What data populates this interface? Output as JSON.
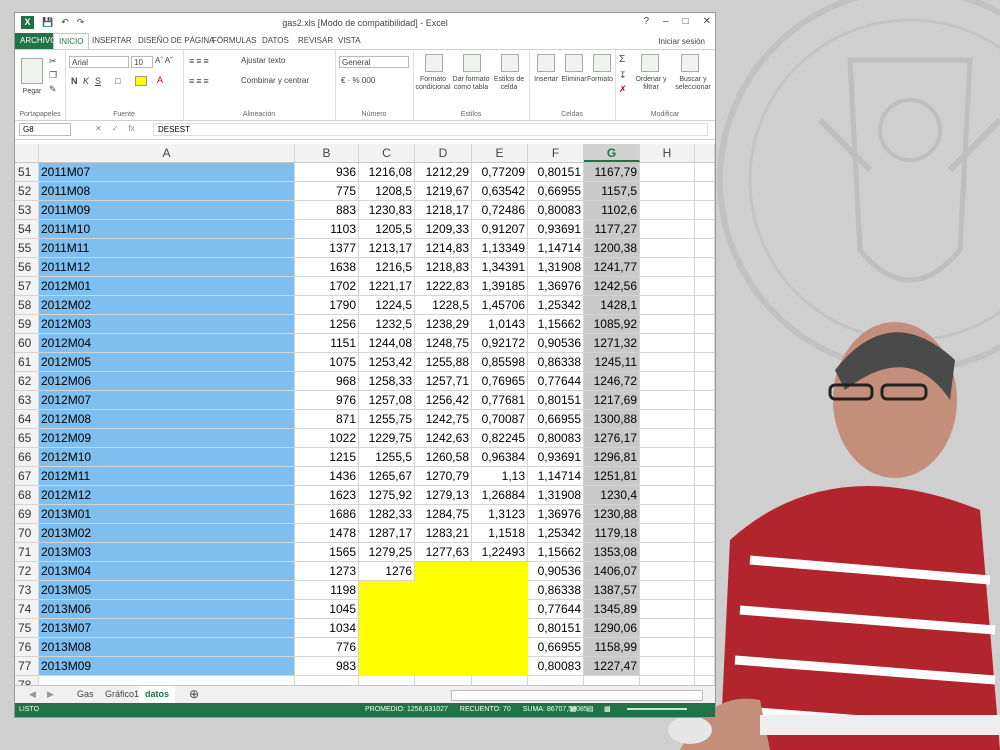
{
  "window": {
    "title": "gas2.xls  [Modo de compatibilidad] - Excel",
    "controls": [
      "?",
      "–",
      "□",
      "✕"
    ]
  },
  "ribbon": {
    "tabs": [
      "ARCHIVO",
      "INICIO",
      "INSERTAR",
      "DISEÑO DE PÁGINA",
      "FÓRMULAS",
      "DATOS",
      "REVISAR",
      "VISTA"
    ],
    "signin": "Iniciar sesión",
    "paste_label": "Pegar",
    "font_name": "Arial",
    "font_size": "10",
    "wrap_text": "Ajustar texto",
    "merge_center": "Combinar y centrar",
    "number_format": "General",
    "buttons": {
      "conditional": "Formato condicional",
      "as_table": "Dar formato como tabla",
      "cell_styles": "Estilos de celda",
      "insert": "Insertar",
      "delete": "Eliminar",
      "format": "Formato",
      "sort": "Ordenar y filtrar",
      "find": "Buscar y seleccionar"
    },
    "groups": [
      "Portapapeles",
      "Fuente",
      "Alineación",
      "Número",
      "Estilos",
      "Celdas",
      "Modificar"
    ]
  },
  "formula_bar": {
    "name_box": "G8",
    "fx": "fx",
    "formula": "DESEST"
  },
  "columns": [
    "A",
    "B",
    "C",
    "D",
    "E",
    "F",
    "G",
    "H"
  ],
  "rows": [
    {
      "n": "51",
      "a": "2011M07",
      "b": "936",
      "c": "1216,08",
      "d": "1212,29",
      "e": "0,77209",
      "f": "0,80151",
      "g": "1167,79"
    },
    {
      "n": "52",
      "a": "2011M08",
      "b": "775",
      "c": "1208,5",
      "d": "1219,67",
      "e": "0,63542",
      "f": "0,66955",
      "g": "1157,5"
    },
    {
      "n": "53",
      "a": "2011M09",
      "b": "883",
      "c": "1230,83",
      "d": "1218,17",
      "e": "0,72486",
      "f": "0,80083",
      "g": "1102,6"
    },
    {
      "n": "54",
      "a": "2011M10",
      "b": "1103",
      "c": "1205,5",
      "d": "1209,33",
      "e": "0,91207",
      "f": "0,93691",
      "g": "1177,27"
    },
    {
      "n": "55",
      "a": "2011M11",
      "b": "1377",
      "c": "1213,17",
      "d": "1214,83",
      "e": "1,13349",
      "f": "1,14714",
      "g": "1200,38"
    },
    {
      "n": "56",
      "a": "2011M12",
      "b": "1638",
      "c": "1216,5",
      "d": "1218,83",
      "e": "1,34391",
      "f": "1,31908",
      "g": "1241,77"
    },
    {
      "n": "57",
      "a": "2012M01",
      "b": "1702",
      "c": "1221,17",
      "d": "1222,83",
      "e": "1,39185",
      "f": "1,36976",
      "g": "1242,56"
    },
    {
      "n": "58",
      "a": "2012M02",
      "b": "1790",
      "c": "1224,5",
      "d": "1228,5",
      "e": "1,45706",
      "f": "1,25342",
      "g": "1428,1"
    },
    {
      "n": "59",
      "a": "2012M03",
      "b": "1256",
      "c": "1232,5",
      "d": "1238,29",
      "e": "1,0143",
      "f": "1,15662",
      "g": "1085,92"
    },
    {
      "n": "60",
      "a": "2012M04",
      "b": "1151",
      "c": "1244,08",
      "d": "1248,75",
      "e": "0,92172",
      "f": "0,90536",
      "g": "1271,32"
    },
    {
      "n": "61",
      "a": "2012M05",
      "b": "1075",
      "c": "1253,42",
      "d": "1255,88",
      "e": "0,85598",
      "f": "0,86338",
      "g": "1245,11"
    },
    {
      "n": "62",
      "a": "2012M06",
      "b": "968",
      "c": "1258,33",
      "d": "1257,71",
      "e": "0,76965",
      "f": "0,77644",
      "g": "1246,72"
    },
    {
      "n": "63",
      "a": "2012M07",
      "b": "976",
      "c": "1257,08",
      "d": "1256,42",
      "e": "0,77681",
      "f": "0,80151",
      "g": "1217,69"
    },
    {
      "n": "64",
      "a": "2012M08",
      "b": "871",
      "c": "1255,75",
      "d": "1242,75",
      "e": "0,70087",
      "f": "0,66955",
      "g": "1300,88"
    },
    {
      "n": "65",
      "a": "2012M09",
      "b": "1022",
      "c": "1229,75",
      "d": "1242,63",
      "e": "0,82245",
      "f": "0,80083",
      "g": "1276,17"
    },
    {
      "n": "66",
      "a": "2012M10",
      "b": "1215",
      "c": "1255,5",
      "d": "1260,58",
      "e": "0,96384",
      "f": "0,93691",
      "g": "1296,81"
    },
    {
      "n": "67",
      "a": "2012M11",
      "b": "1436",
      "c": "1265,67",
      "d": "1270,79",
      "e": "1,13",
      "f": "1,14714",
      "g": "1251,81"
    },
    {
      "n": "68",
      "a": "2012M12",
      "b": "1623",
      "c": "1275,92",
      "d": "1279,13",
      "e": "1,26884",
      "f": "1,31908",
      "g": "1230,4"
    },
    {
      "n": "69",
      "a": "2013M01",
      "b": "1686",
      "c": "1282,33",
      "d": "1284,75",
      "e": "1,3123",
      "f": "1,36976",
      "g": "1230,88"
    },
    {
      "n": "70",
      "a": "2013M02",
      "b": "1478",
      "c": "1287,17",
      "d": "1283,21",
      "e": "1,1518",
      "f": "1,25342",
      "g": "1179,18"
    },
    {
      "n": "71",
      "a": "2013M03",
      "b": "1565",
      "c": "1279,25",
      "d": "1277,63",
      "e": "1,22493",
      "f": "1,15662",
      "g": "1353,08"
    },
    {
      "n": "72",
      "a": "2013M04",
      "b": "1273",
      "c": "1276",
      "d": "",
      "e": "",
      "f": "0,90536",
      "g": "1406,07"
    },
    {
      "n": "73",
      "a": "2013M05",
      "b": "1198",
      "c": "",
      "d": "",
      "e": "",
      "f": "0,86338",
      "g": "1387,57"
    },
    {
      "n": "74",
      "a": "2013M06",
      "b": "1045",
      "c": "",
      "d": "",
      "e": "",
      "f": "0,77644",
      "g": "1345,89"
    },
    {
      "n": "75",
      "a": "2013M07",
      "b": "1034",
      "c": "",
      "d": "",
      "e": "",
      "f": "0,80151",
      "g": "1290,06"
    },
    {
      "n": "76",
      "a": "2013M08",
      "b": "776",
      "c": "",
      "d": "",
      "e": "",
      "f": "0,66955",
      "g": "1158,99"
    },
    {
      "n": "77",
      "a": "2013M09",
      "b": "983",
      "c": "",
      "d": "",
      "e": "",
      "f": "0,80083",
      "g": "1227,47"
    },
    {
      "n": "78",
      "a": "",
      "b": "",
      "c": "",
      "d": "",
      "e": "",
      "f": "",
      "g": ""
    }
  ],
  "sheet_tabs": [
    "Gas",
    "Gráfico1",
    "datos"
  ],
  "active_sheet": "datos",
  "status": {
    "mode": "LISTO",
    "promedio": "PROMEDIO: 1256,631027",
    "recuento": "RECUENTO: 70",
    "suma": "SUMA: 86707,54085"
  },
  "colors": {
    "excel_green": "#217346",
    "selection_blue": "#7fbff0",
    "highlight_yellow": "#ffff00",
    "selected_column_gray": "#c9c9c9"
  }
}
